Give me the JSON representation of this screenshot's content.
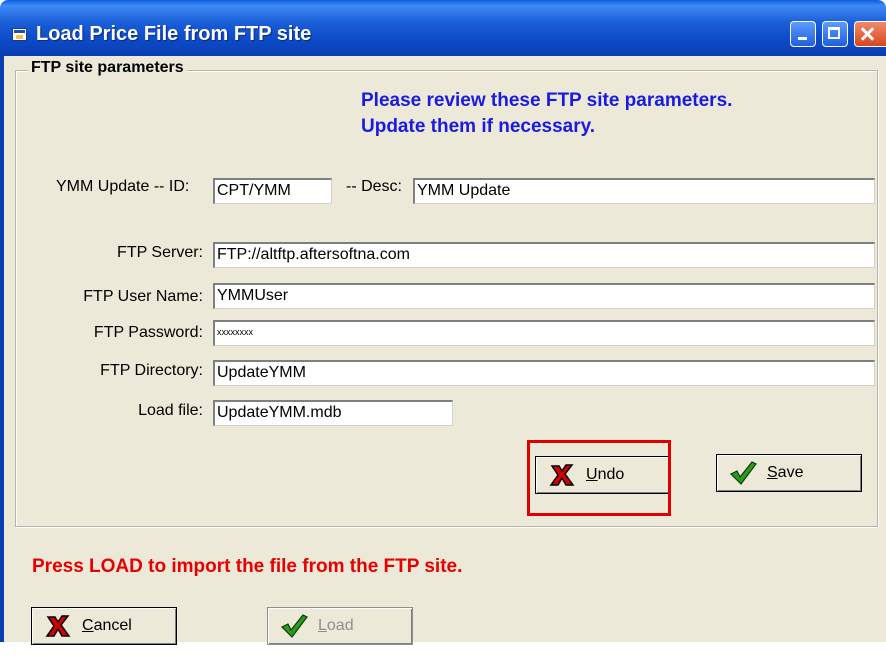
{
  "window": {
    "title": "Load Price File from FTP site"
  },
  "group": {
    "legend": "FTP site parameters"
  },
  "notice": {
    "line1": "Please review these FTP site parameters.",
    "line2": "Update them if necessary."
  },
  "ymm": {
    "id_label": "YMM Update  -- ID:",
    "id_value": "CPT/YMM",
    "desc_label": "-- Desc:",
    "desc_value": "YMM Update"
  },
  "ftp": {
    "server_label": "FTP Server:",
    "server_value": "FTP://altftp.aftersoftna.com",
    "user_label": "FTP User Name:",
    "user_value": "YMMUser",
    "password_label": "FTP Password:",
    "password_value": "xxxxxxxx",
    "directory_label": "FTP Directory:",
    "directory_value": "UpdateYMM",
    "loadfile_label": "Load file:",
    "loadfile_value": "UpdateYMM.mdb"
  },
  "buttons": {
    "undo_label": "Undo",
    "save_label": "Save",
    "cancel_label": "Cancel",
    "load_label": "Load"
  },
  "message": "Press LOAD to import the file from the FTP site.",
  "colors": {
    "titlebar": "#0a47c8",
    "notice": "#1a1ae6",
    "message": "#e80000",
    "highlight": "#e00000",
    "check": "#2a9a1a"
  },
  "icons": {
    "undo": "red-x-icon",
    "save": "green-check-icon",
    "cancel": "red-x-icon",
    "load": "green-check-icon"
  }
}
